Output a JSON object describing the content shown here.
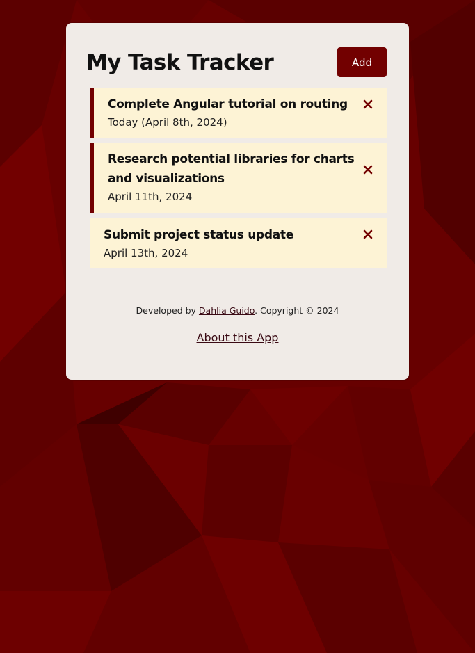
{
  "app": {
    "title": "My Task Tracker",
    "add_label": "Add"
  },
  "tasks": [
    {
      "text": "Complete Angular tutorial on routing",
      "day": "Today (April 8th, 2024)",
      "reminder": true
    },
    {
      "text": "Research potential libraries for charts and visualizations",
      "day": "April 11th, 2024",
      "reminder": true
    },
    {
      "text": "Submit project status update",
      "day": "April 13th, 2024",
      "reminder": false
    }
  ],
  "footer": {
    "prefix": "Developed by ",
    "author": "Dahlia Guido",
    "suffix": ". Copyright © 2024",
    "about_label": "About this App"
  },
  "icons": {
    "delete": "close-icon"
  },
  "colors": {
    "background": "#6a0000",
    "card": "#f0ebe7",
    "accent": "#720000",
    "task_bg": "#fdf3d5"
  }
}
